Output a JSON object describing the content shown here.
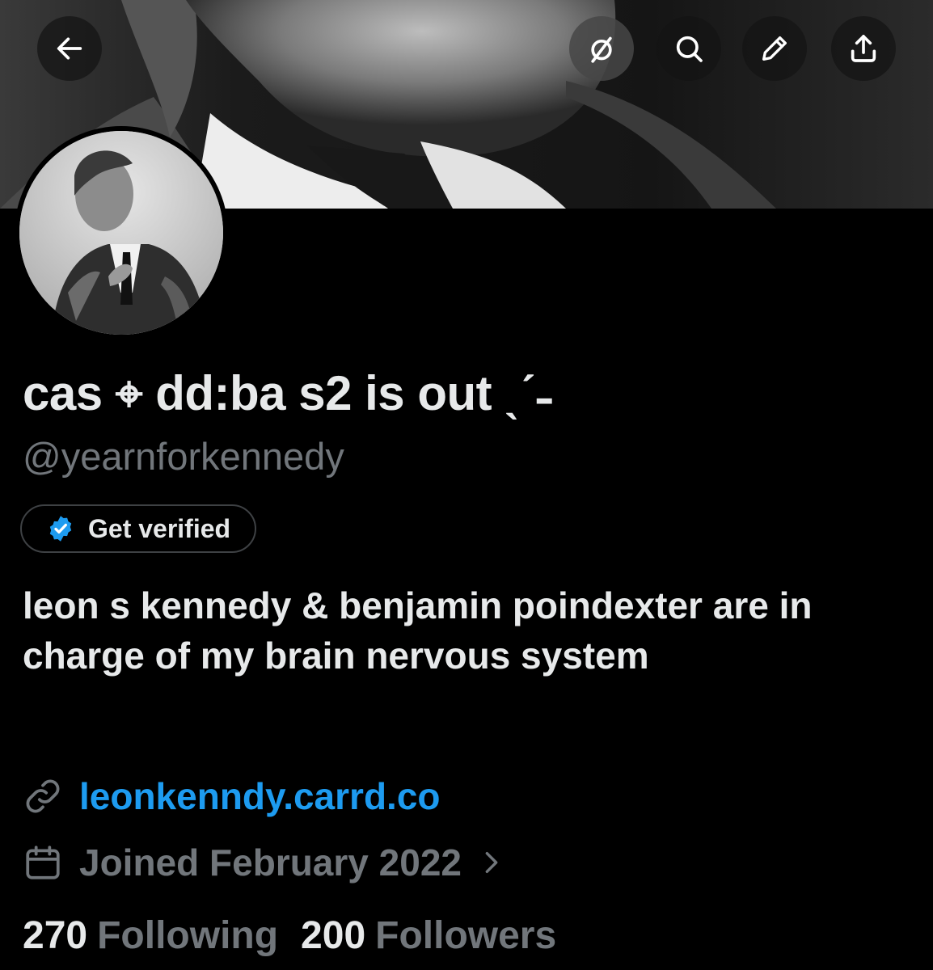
{
  "profile": {
    "display_name": "cas ⌖ dd:ba s2 is out ˎˊ˗",
    "handle": "@yearnforkennedy",
    "verify_label": "Get verified",
    "bio": "leon s kennedy & benjamin poindexter are in charge of my brain nervous system",
    "link": "leonkenndy.carrd.co",
    "joined": "Joined February 2022",
    "following_count": "270",
    "following_label": "Following",
    "followers_count": "200",
    "followers_label": "Followers"
  },
  "nav": {
    "icons": [
      "back-arrow-icon",
      "mute-icon",
      "search-icon",
      "edit-pencil-icon",
      "share-icon"
    ]
  },
  "colors": {
    "background": "#000000",
    "text_primary": "#e7e9ea",
    "text_secondary": "#71767b",
    "link": "#1d9bf0",
    "verified_badge": "#1d9bf0"
  }
}
